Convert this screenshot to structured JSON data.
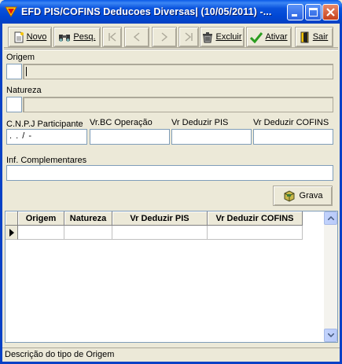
{
  "window": {
    "title": "EFD PIS/COFINS Deducoes Diversas|  (10/05/2011) -..."
  },
  "toolbar": {
    "novo": "Novo",
    "pesq": "Pesq.",
    "excluir": "Excluir",
    "ativar": "Ativar",
    "sair": "Sair"
  },
  "form": {
    "origem_label": "Origem",
    "natureza_label": "Natureza",
    "cnpj_label": "C.N.P.J Participante",
    "cnpj_value": " .   .    /    -",
    "vrbc_label": "Vr.BC Operação",
    "vrpis_label": "Vr Deduzir PIS",
    "vrcofins_label": "Vr Deduzir COFINS",
    "inf_label": "Inf. Complementares",
    "grava": "Grava"
  },
  "grid": {
    "columns": [
      "Origem",
      "Natureza",
      "Vr Deduzir PIS",
      "Vr Deduzir COFINS"
    ]
  },
  "status": {
    "text": "Descrição do tipo de Origem"
  },
  "colors": {
    "titlebar": "#0054e3",
    "face": "#ece9d8",
    "accent_green": "#2a9d1f"
  }
}
